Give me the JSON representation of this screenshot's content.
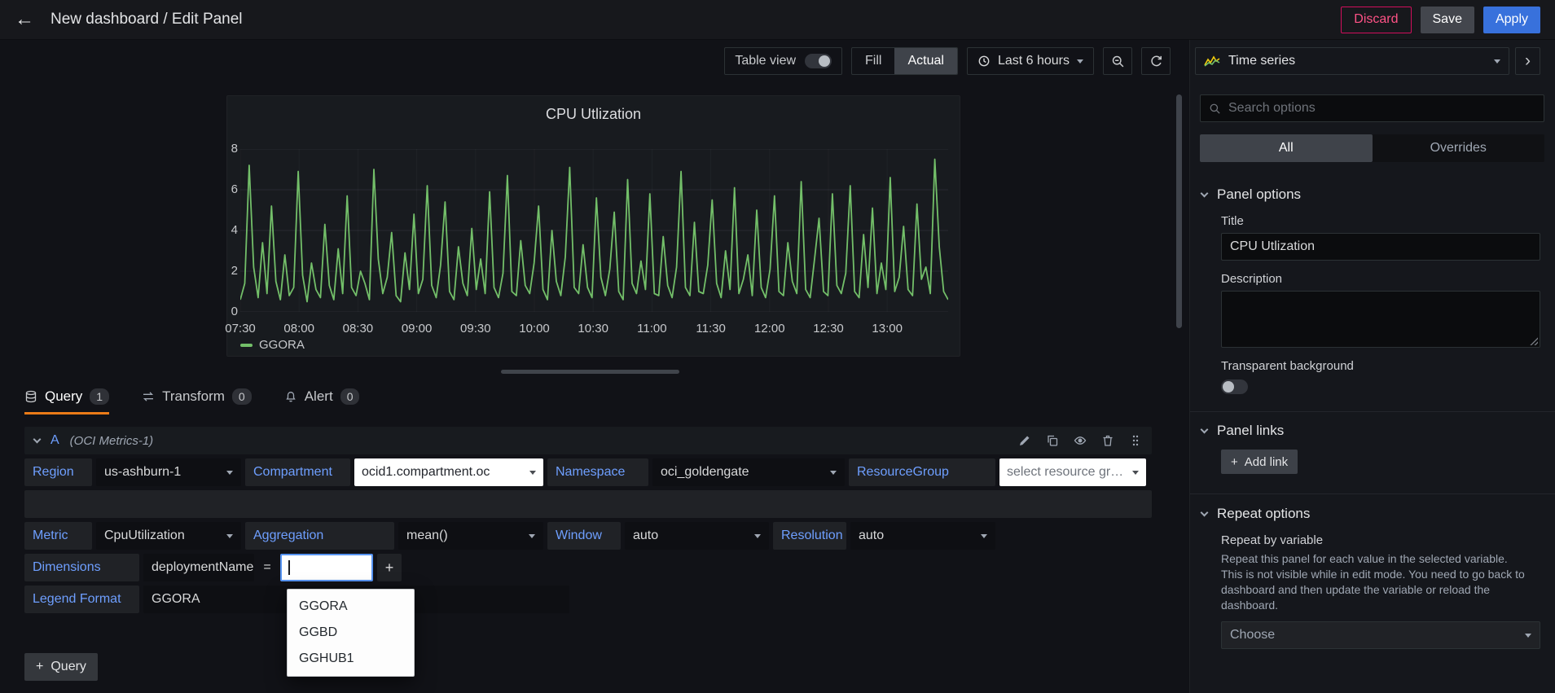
{
  "topbar": {
    "back_icon": "←",
    "title": "New dashboard / Edit Panel",
    "discard": "Discard",
    "save": "Save",
    "apply": "Apply"
  },
  "toolbar": {
    "table_view": "Table view",
    "fill": "Fill",
    "actual": "Actual",
    "time_range": "Last 6 hours"
  },
  "chart_data": {
    "type": "line",
    "title": "CPU Utlization",
    "ylim": [
      0,
      8
    ],
    "yticks": [
      "8",
      "6",
      "4",
      "2",
      "0"
    ],
    "xticks": [
      "07:30",
      "08:00",
      "08:30",
      "09:00",
      "09:30",
      "10:00",
      "10:30",
      "11:00",
      "11:30",
      "12:00",
      "12:30",
      "13:00"
    ],
    "grid": true,
    "legend_position": "bottom-left",
    "series": [
      {
        "name": "GGORA",
        "color": "#73bf69",
        "values": [
          0.6,
          1.4,
          7.2,
          2.2,
          0.7,
          3.4,
          0.9,
          5.2,
          1.5,
          0.6,
          2.8,
          0.8,
          1.2,
          6.9,
          1.8,
          0.5,
          2.4,
          1.1,
          0.7,
          4.3,
          1.3,
          0.6,
          3.1,
          0.9,
          5.7,
          1.2,
          0.8,
          2.0,
          1.4,
          0.6,
          7.0,
          2.6,
          0.9,
          1.7,
          3.9,
          0.8,
          0.5,
          2.9,
          1.1,
          4.8,
          0.9,
          1.6,
          6.2,
          1.3,
          0.7,
          2.3,
          5.4,
          1.0,
          0.6,
          3.2,
          1.4,
          0.8,
          4.1,
          1.1,
          2.6,
          0.9,
          5.9,
          1.2,
          0.7,
          1.9,
          6.7,
          1.0,
          0.8,
          3.5,
          1.3,
          0.9,
          2.4,
          5.2,
          1.1,
          0.6,
          4.0,
          1.5,
          0.8,
          2.7,
          7.1,
          1.2,
          0.9,
          3.3,
          1.2,
          0.7,
          5.6,
          1.7,
          0.8,
          2.1,
          4.9,
          1.0,
          0.6,
          6.5,
          1.4,
          0.9,
          2.5,
          1.1,
          5.8,
          0.9,
          0.8,
          3.7,
          1.3,
          0.7,
          2.2,
          6.9,
          1.2,
          0.8,
          4.4,
          1.0,
          0.9,
          2.3,
          5.5,
          1.4,
          0.7,
          3.0,
          1.1,
          6.1,
          0.9,
          1.6,
          2.8,
          0.8,
          5.0,
          1.2,
          0.7,
          2.1,
          5.7,
          1.0,
          0.8,
          3.4,
          1.5,
          0.9,
          6.4,
          1.1,
          0.7,
          2.6,
          4.6,
          1.0,
          0.8,
          5.8,
          1.3,
          0.9,
          1.9,
          6.2,
          1.0,
          0.7,
          3.8,
          1.2,
          5.1,
          0.9,
          2.4,
          1.1,
          6.6,
          1.0,
          1.7,
          4.2,
          1.1,
          0.8,
          5.3,
          1.6,
          2.2,
          0.9,
          7.5,
          3.2,
          1.0,
          0.6
        ]
      }
    ]
  },
  "editor_tabs": {
    "query": {
      "label": "Query",
      "badge": "1"
    },
    "transform": {
      "label": "Transform",
      "badge": "0"
    },
    "alert": {
      "label": "Alert",
      "badge": "0"
    }
  },
  "query": {
    "ref_id": "A",
    "datasource": "(OCI Metrics-1)",
    "fields": {
      "region": {
        "label": "Region",
        "value": "us-ashburn-1"
      },
      "compartment": {
        "label": "Compartment",
        "value": "ocid1.compartment.oc"
      },
      "namespace": {
        "label": "Namespace",
        "value": "oci_goldengate"
      },
      "resourcegroup": {
        "label": "ResourceGroup",
        "placeholder": "select resource group"
      },
      "metric": {
        "label": "Metric",
        "value": "CpuUtilization"
      },
      "aggregation": {
        "label": "Aggregation",
        "value": "mean()"
      },
      "window": {
        "label": "Window",
        "value": "auto"
      },
      "resolution": {
        "label": "Resolution",
        "value": "auto"
      },
      "dimensions": {
        "label": "Dimensions",
        "key": "deploymentName",
        "operator": "=",
        "value": "",
        "add_icon": "+"
      },
      "legend_format": {
        "label": "Legend Format",
        "value": "GGORA"
      }
    },
    "dimension_options": [
      "GGORA",
      "GGBD",
      "GGHUB1"
    ],
    "add_query_icon": "+",
    "add_query": "Query"
  },
  "sidebar": {
    "viz": {
      "name": "Time series",
      "collapse_icon": "›"
    },
    "search_placeholder": "Search options",
    "tabs": {
      "all": "All",
      "overrides": "Overrides"
    },
    "panel_options": {
      "header": "Panel options",
      "title_label": "Title",
      "title_value": "CPU Utlization",
      "description_label": "Description",
      "description_value": "",
      "transparent_label": "Transparent background"
    },
    "panel_links": {
      "header": "Panel links",
      "add_icon": "+",
      "add_link": "Add link"
    },
    "repeat_options": {
      "header": "Repeat options",
      "label": "Repeat by variable",
      "help": "Repeat this panel for each value in the selected variable. This is not visible while in edit mode. You need to go back to dashboard and then update the variable or reload the dashboard.",
      "choose": "Choose"
    }
  },
  "colors": {
    "accent_blue": "#3871dc",
    "link_blue": "#6e9fff",
    "destructive_red": "#ff5286",
    "active_tab_orange": "#eb7b18",
    "series_green": "#73bf69"
  }
}
